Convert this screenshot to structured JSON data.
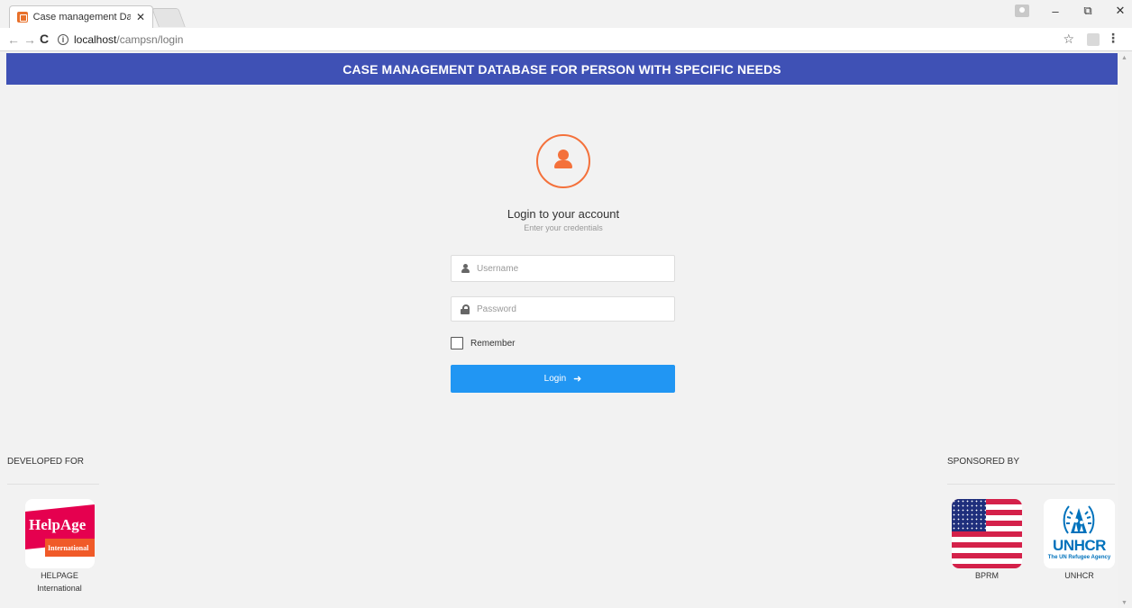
{
  "browser": {
    "tab_title": "Case management Datab",
    "tab_close": "✕",
    "url_host": "localhost",
    "url_path": "/campsn/login",
    "window_minimize": "–",
    "window_restore": "⧉",
    "window_close": "✕"
  },
  "header": {
    "title": "CASE MANAGEMENT DATABASE FOR PERSON WITH SPECIFIC NEEDS",
    "background": "#3f51b5"
  },
  "login": {
    "title": "Login to your account",
    "subtitle": "Enter your credentials",
    "username_placeholder": "Username",
    "username_value": "",
    "password_placeholder": "Password",
    "password_value": "",
    "remember_label": "Remember",
    "remember_checked": false,
    "button_label": "Login",
    "button_icon": "arrow-right-icon",
    "button_color": "#2196f3",
    "avatar_color": "#f4713b"
  },
  "footer": {
    "developed_for_label": "DEVELOPED FOR",
    "sponsored_by_label": "SPONSORED BY",
    "developed_for": [
      {
        "logo_text": "HelpAge",
        "logo_subtext": "International",
        "caption_line1": "HELPAGE",
        "caption_line2": "International"
      }
    ],
    "sponsors": [
      {
        "caption": "BPRM"
      },
      {
        "logo_text": "UNHCR",
        "logo_subtext": "The UN Refugee Agency",
        "caption": "UNHCR"
      }
    ]
  }
}
